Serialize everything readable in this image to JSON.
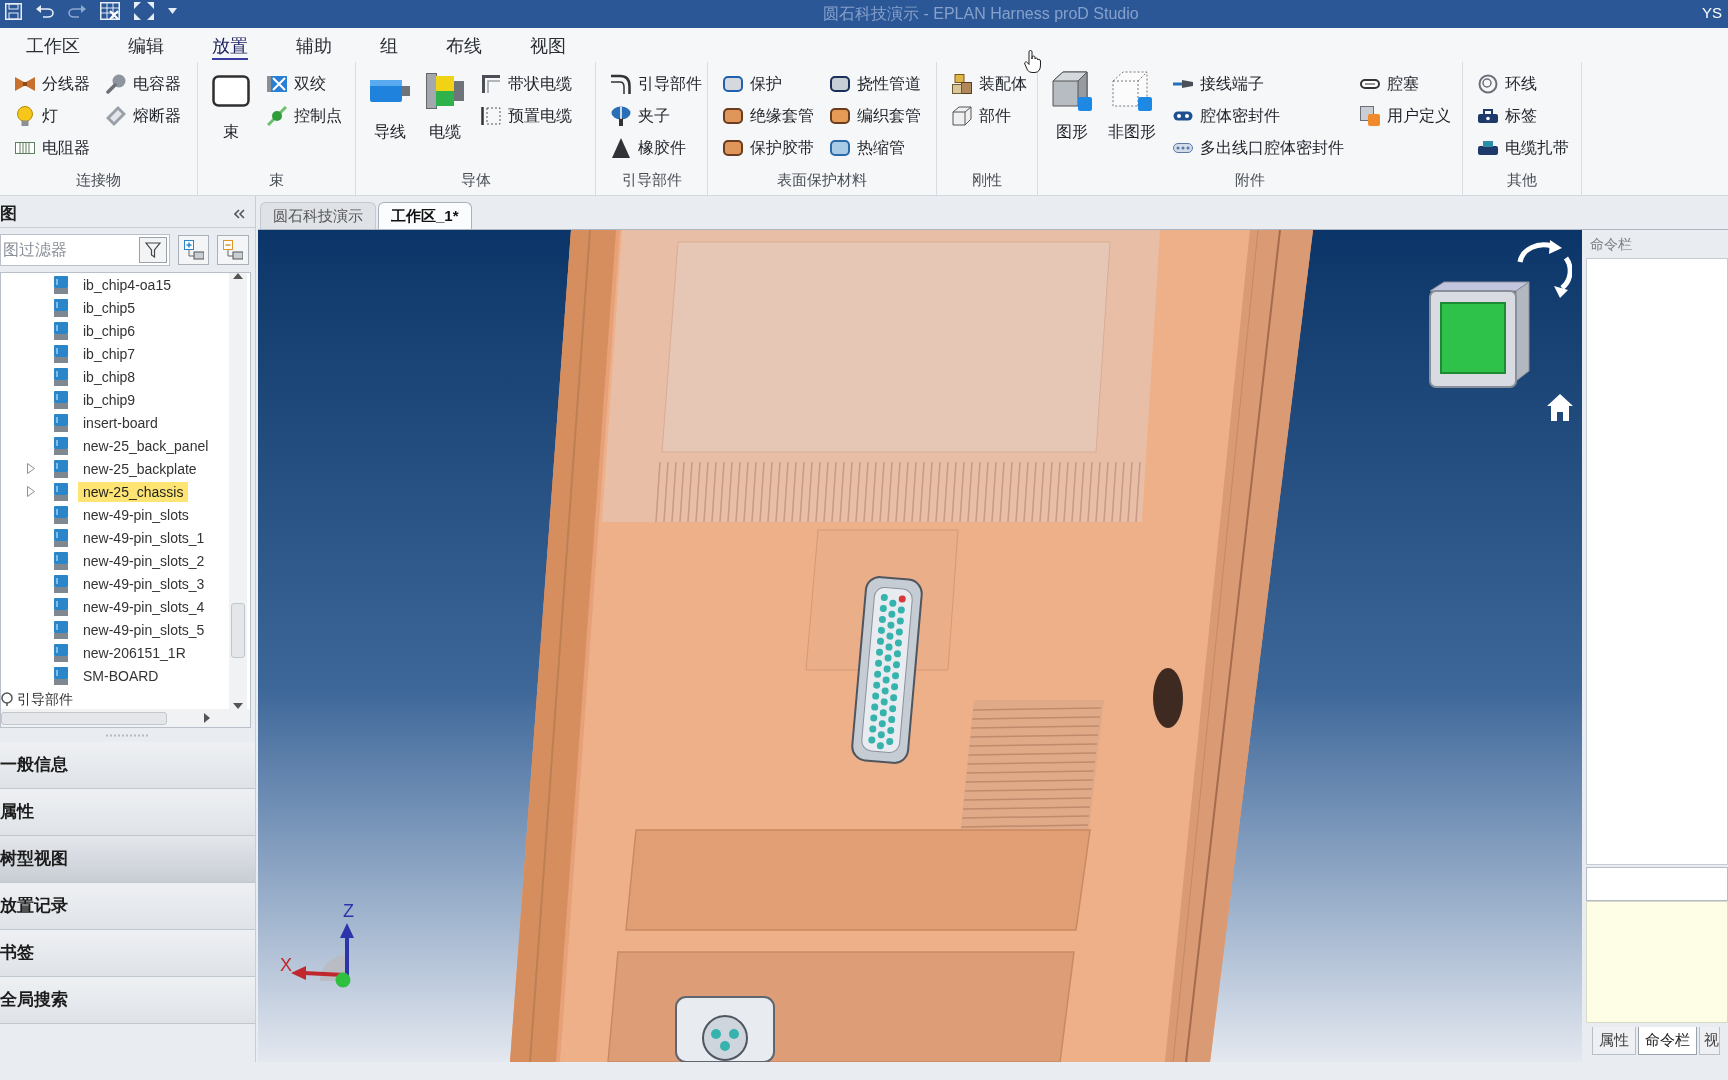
{
  "title_bar": {
    "title": "圆石科技演示 - EPLAN Harness proD Studio",
    "user": "YS"
  },
  "menu_tabs": [
    {
      "label": "工作区",
      "selected": false
    },
    {
      "label": "编辑",
      "selected": false
    },
    {
      "label": "放置",
      "selected": true
    },
    {
      "label": "辅助",
      "selected": false
    },
    {
      "label": "组",
      "selected": false
    },
    {
      "label": "布线",
      "selected": false
    },
    {
      "label": "视图",
      "selected": false
    }
  ],
  "ribbon": {
    "groups": [
      {
        "label": "连接物",
        "buttons": [
          {
            "label": "分线器",
            "kind": "small"
          },
          {
            "label": "灯",
            "kind": "small"
          },
          {
            "label": "电阻器",
            "kind": "small"
          },
          {
            "label": "电容器",
            "kind": "small"
          },
          {
            "label": "熔断器",
            "kind": "small"
          }
        ]
      },
      {
        "label": "束",
        "buttons": [
          {
            "label": "束",
            "kind": "large"
          },
          {
            "label": "双绞",
            "kind": "small"
          },
          {
            "label": "控制点",
            "kind": "small"
          }
        ]
      },
      {
        "label": "导体",
        "buttons": [
          {
            "label": "导线",
            "kind": "large"
          },
          {
            "label": "电缆",
            "kind": "large"
          },
          {
            "label": "带状电缆",
            "kind": "small"
          },
          {
            "label": "预置电缆",
            "kind": "small"
          }
        ]
      },
      {
        "label": "引导部件",
        "buttons": [
          {
            "label": "引导部件",
            "kind": "small"
          },
          {
            "label": "夹子",
            "kind": "small"
          },
          {
            "label": "橡胶件",
            "kind": "small"
          }
        ]
      },
      {
        "label": "表面保护材料",
        "buttons": [
          {
            "label": "保护",
            "kind": "small"
          },
          {
            "label": "绝缘套管",
            "kind": "small"
          },
          {
            "label": "保护胶带",
            "kind": "small"
          },
          {
            "label": "挠性管道",
            "kind": "small"
          },
          {
            "label": "编织套管",
            "kind": "small"
          },
          {
            "label": "热缩管",
            "kind": "small"
          }
        ]
      },
      {
        "label": "刚性",
        "buttons": [
          {
            "label": "装配体",
            "kind": "small"
          },
          {
            "label": "部件",
            "kind": "small"
          }
        ]
      },
      {
        "label": "附件",
        "buttons": [
          {
            "label": "图形",
            "kind": "large"
          },
          {
            "label": "非图形",
            "kind": "large"
          },
          {
            "label": "接线端子",
            "kind": "small"
          },
          {
            "label": "腔体密封件",
            "kind": "small"
          },
          {
            "label": "多出线口腔体密封件",
            "kind": "small"
          },
          {
            "label": "腔塞",
            "kind": "small"
          },
          {
            "label": "用户定义",
            "kind": "small"
          }
        ]
      },
      {
        "label": "其他",
        "buttons": [
          {
            "label": "环线",
            "kind": "small"
          },
          {
            "label": "标签",
            "kind": "small"
          },
          {
            "label": "电缆扎带",
            "kind": "small"
          }
        ]
      }
    ]
  },
  "left_panel": {
    "title": "图",
    "filter": {
      "placeholder": "图过滤器"
    },
    "tree": {
      "items": [
        {
          "children": [
            {
              "label": "ib_chip4-oa15",
              "expandable": false,
              "selected": false
            },
            {
              "label": "ib_chip5",
              "expandable": false,
              "selected": false
            },
            {
              "label": "ib_chip6",
              "expandable": false,
              "selected": false
            },
            {
              "label": "ib_chip7",
              "expandable": false,
              "selected": false
            },
            {
              "label": "ib_chip8",
              "expandable": false,
              "selected": false
            },
            {
              "label": "ib_chip9",
              "expandable": false,
              "selected": false
            },
            {
              "label": "insert-board",
              "expandable": false,
              "selected": false
            },
            {
              "label": "new-25_back_panel",
              "expandable": false,
              "selected": false
            },
            {
              "label": "new-25_backplate",
              "expandable": true,
              "selected": false
            },
            {
              "label": "new-25_chassis",
              "expandable": true,
              "selected": true
            },
            {
              "label": "new-49-pin_slots",
              "expandable": false,
              "selected": false
            },
            {
              "label": "new-49-pin_slots_1",
              "expandable": false,
              "selected": false
            },
            {
              "label": "new-49-pin_slots_2",
              "expandable": false,
              "selected": false
            },
            {
              "label": "new-49-pin_slots_3",
              "expandable": false,
              "selected": false
            },
            {
              "label": "new-49-pin_slots_4",
              "expandable": false,
              "selected": false
            },
            {
              "label": "new-49-pin_slots_5",
              "expandable": false,
              "selected": false
            },
            {
              "label": "new-206151_1R",
              "expandable": false,
              "selected": false
            },
            {
              "label": "SM-BOARD",
              "expandable": false,
              "selected": false
            }
          ]
        },
        {
          "label": "引导部件",
          "selected": false
        }
      ]
    },
    "sections": [
      {
        "label": "一般信息",
        "selected": false
      },
      {
        "label": "属性",
        "selected": false
      },
      {
        "label": "树型视图",
        "selected": true
      },
      {
        "label": "放置记录",
        "selected": false
      },
      {
        "label": "书签",
        "selected": false
      },
      {
        "label": "全局搜索",
        "selected": false
      }
    ]
  },
  "document_tabs": [
    {
      "label": "圆石科技演示",
      "selected": false
    },
    {
      "label": "工作区_1*",
      "selected": true
    }
  ],
  "viewport": {
    "axes": [
      {
        "label": "Z",
        "color": "#2b34a8"
      },
      {
        "label": "X",
        "color": "#c0282d"
      }
    ]
  },
  "right_panel": {
    "title": "命令栏",
    "tabs": [
      {
        "label": "属性",
        "selected": false
      },
      {
        "label": "命令栏",
        "selected": true
      },
      {
        "label": "视",
        "selected": false
      }
    ]
  }
}
